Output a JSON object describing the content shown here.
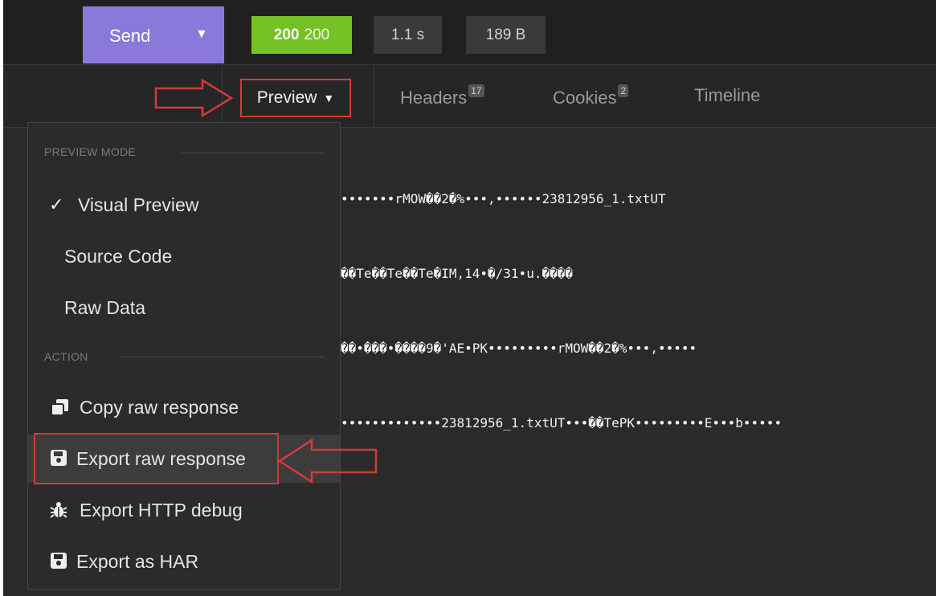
{
  "toolbar": {
    "send_label": "Send",
    "send_caret": "▼",
    "status_code": "200",
    "status_text": "200",
    "time": "1.1 s",
    "size": "189 B"
  },
  "tabs": {
    "preview_label": "Preview",
    "preview_caret": "▼",
    "headers_label": "Headers",
    "headers_count": "17",
    "cookies_label": "Cookies",
    "cookies_count": "2",
    "timeline_label": "Timeline"
  },
  "response_lines": [
    "•••••••rMOW��2�%•••,••••••23812956_1.txtUT",
    "��Te��Te��Te�IM,14•�/31•u.����",
    "��•���•����9�'AE•PK•••••••••rMOW��2�%•••,•••••",
    "•••••••••••••23812956_1.txtUT•••��TePK•••••••••E•••b•••••"
  ],
  "menu": {
    "preview_mode_label": "PREVIEW MODE",
    "action_label": "ACTION",
    "check_icon": "✓",
    "visual_preview": "Visual Preview",
    "source_code": "Source Code",
    "raw_data": "Raw Data",
    "copy_raw": "Copy raw response",
    "export_raw": "Export raw response",
    "export_http_debug": "Export HTTP debug",
    "export_har": "Export as HAR"
  },
  "colors": {
    "send": "#8b78db",
    "status_ok": "#76c225",
    "highlight": "#d23a3a",
    "background": "#2a2a2a"
  }
}
